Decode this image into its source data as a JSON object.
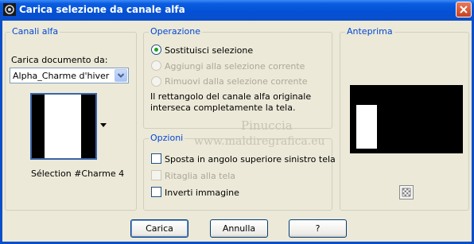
{
  "window": {
    "title": "Carica selezione da canale alfa"
  },
  "alpha_channels": {
    "group_label": "Canali alfa",
    "load_doc_label": "Carica documento da:",
    "document_selected": "Alpha_Charme d'hiver",
    "selection_name": "Sélection #Charme 4"
  },
  "operation": {
    "group_label": "Operazione",
    "options": [
      {
        "label": "Sostituisci selezione",
        "checked": true,
        "enabled": true
      },
      {
        "label": "Aggiungi alla selezione corrente",
        "checked": false,
        "enabled": false
      },
      {
        "label": "Rimuovi dalla selezione corrente",
        "checked": false,
        "enabled": false
      }
    ],
    "info_line1": "Il rettangolo del canale alfa originale",
    "info_line2": "interseca completamente la tela."
  },
  "options": {
    "group_label": "Opzioni",
    "items": [
      {
        "label": "Sposta in angolo superiore sinistro tela",
        "checked": false,
        "enabled": true
      },
      {
        "label": "Ritaglia alla tela",
        "checked": false,
        "enabled": false
      },
      {
        "label": "Inverti immagine",
        "checked": false,
        "enabled": true
      }
    ]
  },
  "preview": {
    "group_label": "Anteprima"
  },
  "watermark": {
    "line1": "Pinuccia",
    "line2": "www.maldiregrafica.eu"
  },
  "buttons": {
    "load": "Carica",
    "cancel": "Annulla",
    "help": "?"
  },
  "colors": {
    "title_bar": "#0a5ce0",
    "accent_label": "#0046d5",
    "dialog_bg": "#ece9d8"
  }
}
